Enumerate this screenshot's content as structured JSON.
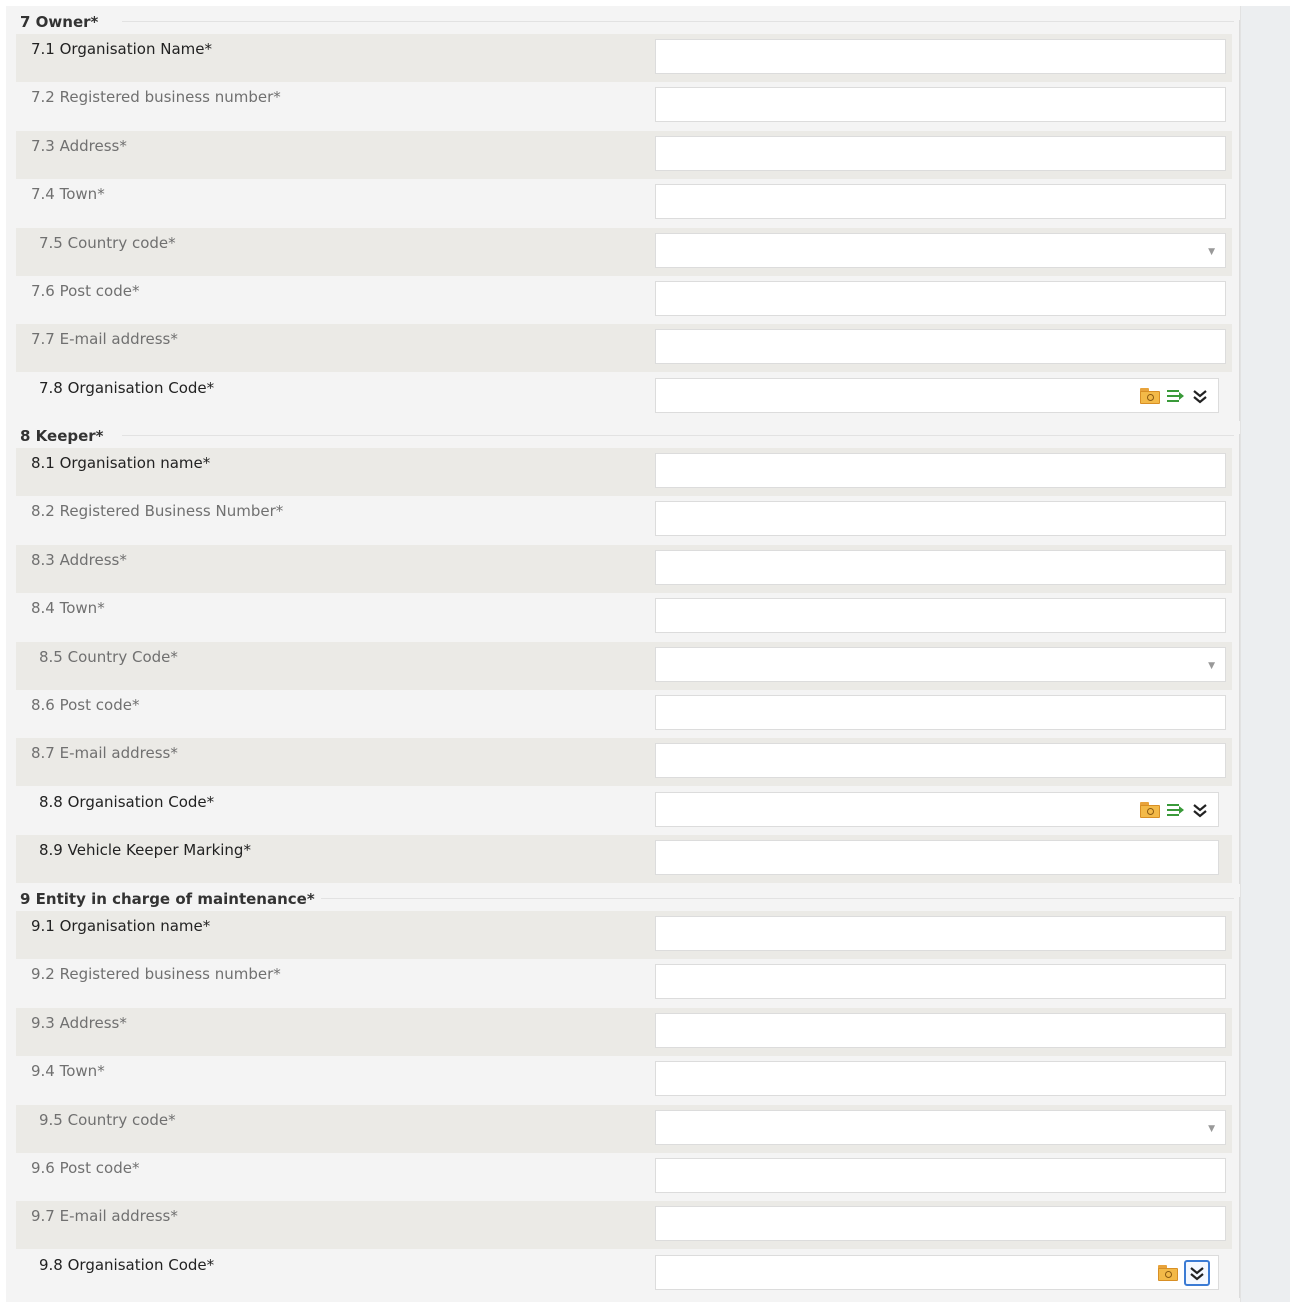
{
  "sections": [
    {
      "title": "7 Owner*",
      "rows": [
        {
          "label": "7.1 Organisation Name*",
          "type": "text",
          "value": "",
          "shade": true,
          "indent": false,
          "dark": true
        },
        {
          "label": "7.2 Registered business number*",
          "type": "text",
          "value": "",
          "shade": false,
          "indent": false,
          "dark": false
        },
        {
          "label": "7.3 Address*",
          "type": "text",
          "value": "",
          "shade": true,
          "indent": false,
          "dark": false
        },
        {
          "label": "7.4 Town*",
          "type": "text",
          "value": "",
          "shade": false,
          "indent": false,
          "dark": false
        },
        {
          "label": "7.5 Country code*",
          "type": "select",
          "value": "",
          "shade": true,
          "indent": true,
          "dark": false
        },
        {
          "label": "7.6 Post code*",
          "type": "text",
          "value": "",
          "shade": false,
          "indent": false,
          "dark": false
        },
        {
          "label": "7.7 E-mail address*",
          "type": "text",
          "value": "",
          "shade": true,
          "indent": false,
          "dark": false
        },
        {
          "label": "7.8 Organisation Code*",
          "type": "lookup",
          "value": "",
          "shade": false,
          "indent": true,
          "dark": true,
          "icons": [
            "folder-search-icon",
            "list-transfer-icon",
            "double-chevron-down-icon"
          ]
        }
      ]
    },
    {
      "title": "8 Keeper*",
      "rows": [
        {
          "label": "8.1 Organisation name*",
          "type": "text",
          "value": "",
          "shade": true,
          "indent": false,
          "dark": true
        },
        {
          "label": "8.2 Registered Business Number*",
          "type": "text",
          "value": "",
          "shade": false,
          "indent": false,
          "dark": false
        },
        {
          "label": "8.3 Address*",
          "type": "text",
          "value": "",
          "shade": true,
          "indent": false,
          "dark": false
        },
        {
          "label": "8.4 Town*",
          "type": "text",
          "value": "",
          "shade": false,
          "indent": false,
          "dark": false
        },
        {
          "label": "8.5 Country Code*",
          "type": "select",
          "value": "",
          "shade": true,
          "indent": true,
          "dark": false
        },
        {
          "label": "8.6 Post code*",
          "type": "text",
          "value": "",
          "shade": false,
          "indent": false,
          "dark": false
        },
        {
          "label": "8.7 E-mail address*",
          "type": "text",
          "value": "",
          "shade": true,
          "indent": false,
          "dark": false
        },
        {
          "label": "8.8 Organisation Code*",
          "type": "lookup",
          "value": "",
          "shade": false,
          "indent": true,
          "dark": true,
          "icons": [
            "folder-search-icon",
            "list-transfer-icon",
            "double-chevron-down-icon"
          ]
        },
        {
          "label": "8.9 Vehicle Keeper Marking*",
          "type": "text-narrow",
          "value": "",
          "shade": true,
          "indent": true,
          "dark": true
        }
      ]
    },
    {
      "title": "9 Entity in charge of maintenance*",
      "rows": [
        {
          "label": "9.1 Organisation name*",
          "type": "text",
          "value": "",
          "shade": true,
          "indent": false,
          "dark": true
        },
        {
          "label": "9.2 Registered business number*",
          "type": "text",
          "value": "",
          "shade": false,
          "indent": false,
          "dark": false
        },
        {
          "label": "9.3 Address*",
          "type": "text",
          "value": "",
          "shade": true,
          "indent": false,
          "dark": false
        },
        {
          "label": "9.4 Town*",
          "type": "text",
          "value": "",
          "shade": false,
          "indent": false,
          "dark": false
        },
        {
          "label": "9.5 Country code*",
          "type": "select",
          "value": "",
          "shade": true,
          "indent": true,
          "dark": false
        },
        {
          "label": "9.6 Post code*",
          "type": "text",
          "value": "",
          "shade": false,
          "indent": false,
          "dark": false
        },
        {
          "label": "9.7 E-mail address*",
          "type": "text",
          "value": "",
          "shade": true,
          "indent": false,
          "dark": false
        },
        {
          "label": "9.8 Organisation Code*",
          "type": "lookup",
          "value": "",
          "shade": false,
          "indent": true,
          "dark": true,
          "icons": [
            "folder-search-icon",
            "double-chevron-down-icon"
          ],
          "focused_icon": "double-chevron-down-icon"
        }
      ]
    }
  ],
  "colors": {
    "row_shade": "#ebeae6",
    "page_background": "#f4f4f4",
    "focus_outline": "#3b7bd4",
    "list_icon": "#3a9a3a",
    "folder_icon": "#f3b948"
  }
}
